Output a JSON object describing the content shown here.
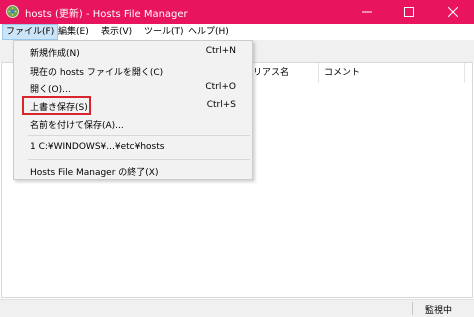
{
  "window": {
    "title": "hosts (更新) - Hosts File Manager"
  },
  "menubar": {
    "items": [
      "ファイル(F)",
      "編集(E)",
      "表示(V)",
      "ツール(T)",
      "ヘルプ(H)"
    ]
  },
  "file_menu": {
    "items": [
      {
        "label": "新規作成(N)",
        "shortcut": "Ctrl+N"
      },
      {
        "label": "現在の hosts ファイルを開く(C)",
        "shortcut": ""
      },
      {
        "label": "開く(O)...",
        "shortcut": "Ctrl+O"
      },
      {
        "label": "上書き保存(S)",
        "shortcut": "Ctrl+S"
      },
      {
        "label": "名前を付けて保存(A)...",
        "shortcut": ""
      },
      {
        "label": "1 C:¥WINDOWS¥...¥etc¥hosts",
        "shortcut": ""
      },
      {
        "label": "Hosts File Manager の終了(X)",
        "shortcut": ""
      }
    ]
  },
  "list": {
    "columns": [
      "イリアス名",
      "コメント"
    ]
  },
  "status": {
    "text": "監視中"
  },
  "colors": {
    "titlebar": "#e8145d",
    "highlight": "#d9262c"
  },
  "icons": [
    "app-icon",
    "minimize-icon",
    "maximize-icon",
    "close-icon"
  ]
}
